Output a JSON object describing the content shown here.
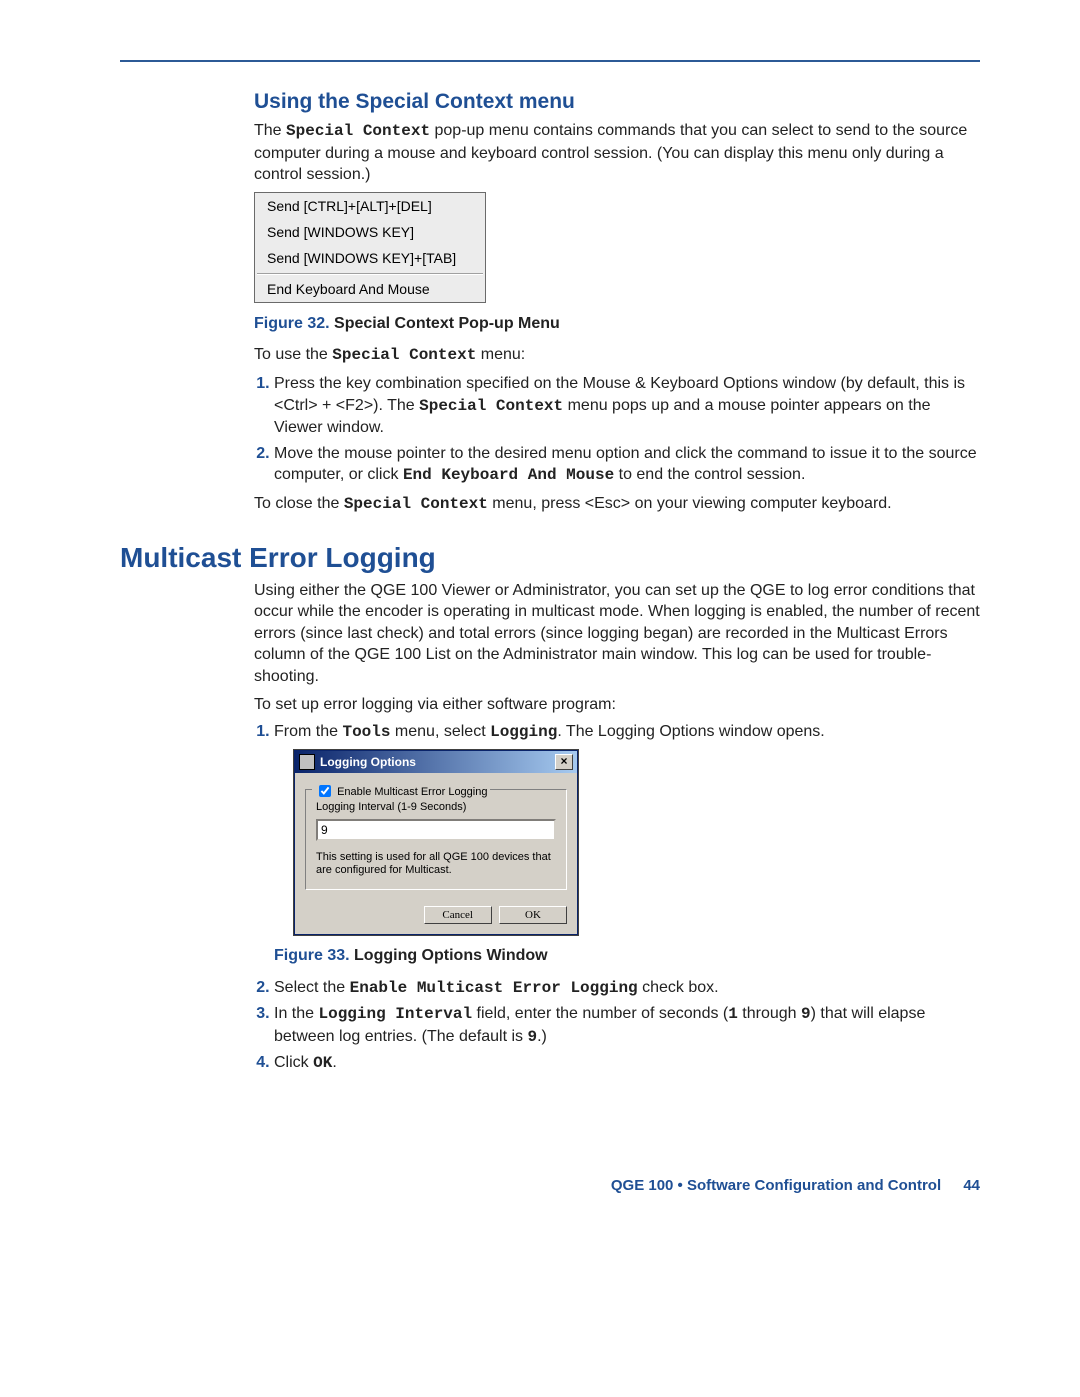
{
  "section1": {
    "heading": "Using the Special Context menu",
    "intro_part1": "The ",
    "intro_mono1": "Special Context",
    "intro_part2": " pop-up menu contains commands that you can select to send to the source computer during a mouse and keyboard control session. (You can display this menu only during a control session.)",
    "menu_items": {
      "a": "Send [CTRL]+[ALT]+[DEL]",
      "b": "Send [WINDOWS KEY]",
      "c": "Send [WINDOWS KEY]+[TAB]",
      "d": "End Keyboard And Mouse"
    },
    "fig_label_num": "Figure 32.",
    "fig_label_txt": " Special Context Pop-up Menu",
    "intro2_a": "To use the ",
    "intro2_mono": "Special Context",
    "intro2_b": " menu:",
    "steps": {
      "s1_a": "Press the key combination specified on the Mouse & Keyboard Options window (by default, this is <Ctrl> + <F2>). The ",
      "s1_mono": "Special Context",
      "s1_b": " menu pops up and a mouse pointer appears on the Viewer window.",
      "s2_a": "Move the mouse pointer to the desired menu option and click the command to issue it to the source computer, or click ",
      "s2_mono": "End Keyboard And Mouse",
      "s2_b": " to end the control session."
    },
    "close_a": "To close the ",
    "close_mono": "Special Context",
    "close_b": " menu, press <Esc> on your viewing computer keyboard."
  },
  "section2": {
    "heading": "Multicast Error Logging",
    "intro": "Using either the QGE 100 Viewer or Administrator, you can set up the QGE to log error conditions that occur while the encoder is operating in multicast mode. When logging is enabled, the number of recent errors (since last check) and total errors (since logging began) are recorded in the Multicast Errors column of the QGE 100 List on the Administrator main window. This log can be used for trouble-shooting.",
    "intro2": "To set up error logging via either software program:",
    "step1_a": "From the ",
    "step1_mono1": "Tools",
    "step1_b": " menu, select ",
    "step1_mono2": "Logging",
    "step1_c": ". The Logging Options window opens.",
    "dialog": {
      "title": "Logging Options",
      "legend": "Enable Multicast Error Logging",
      "label": "Logging Interval (1-9 Seconds)",
      "value": "9",
      "hint": "This setting is used for all QGE 100 devices that are configured for Multicast.",
      "cancel": "Cancel",
      "ok": "OK"
    },
    "fig_label_num": "Figure 33.",
    "fig_label_txt": "  Logging Options Window",
    "step2_a": "Select the ",
    "step2_mono": "Enable Multicast Error Logging",
    "step2_b": " check box.",
    "step3_a": "In the ",
    "step3_mono": "Logging Interval",
    "step3_b": " field, enter the number of seconds (",
    "step3_mono2": "1",
    "step3_c": " through ",
    "step3_mono3": "9",
    "step3_d": ") that will elapse between log entries. (The default is ",
    "step3_mono4": "9",
    "step3_e": ".)",
    "step4_a": "Click ",
    "step4_mono": "OK",
    "step4_b": "."
  },
  "footer": {
    "product": "QGE 100 • Software Configuration and Control",
    "page": "44"
  }
}
